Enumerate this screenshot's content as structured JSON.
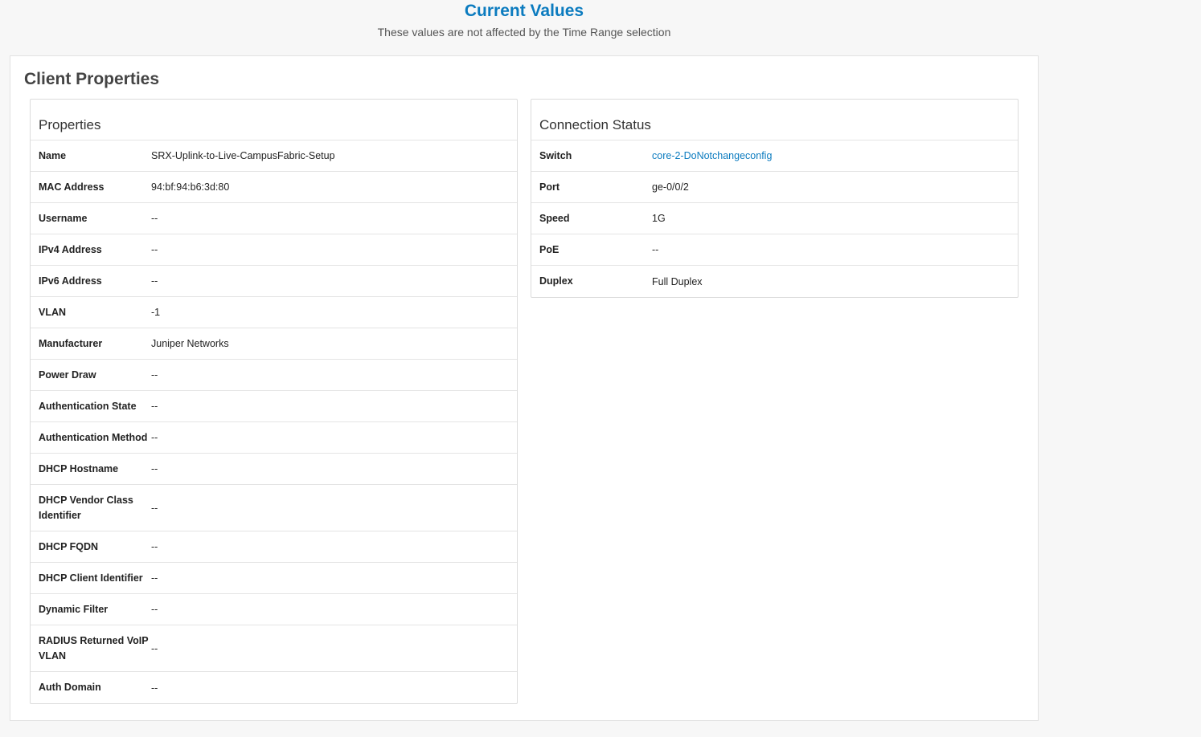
{
  "header": {
    "title": "Current Values",
    "subtitle": "These values are not affected by the Time Range selection"
  },
  "card": {
    "title": "Client Properties"
  },
  "properties": {
    "title": "Properties",
    "rows": [
      {
        "key": "Name",
        "value": "SRX-Uplink-to-Live-CampusFabric-Setup"
      },
      {
        "key": "MAC Address",
        "value": "94:bf:94:b6:3d:80"
      },
      {
        "key": "Username",
        "value": "--"
      },
      {
        "key": "IPv4 Address",
        "value": "--"
      },
      {
        "key": "IPv6 Address",
        "value": "--"
      },
      {
        "key": "VLAN",
        "value": "-1"
      },
      {
        "key": "Manufacturer",
        "value": "Juniper Networks"
      },
      {
        "key": "Power Draw",
        "value": "--"
      },
      {
        "key": "Authentication State",
        "value": "--"
      },
      {
        "key": "Authentication Method",
        "value": "--"
      },
      {
        "key": "DHCP Hostname",
        "value": "--"
      },
      {
        "key": "DHCP Vendor Class Identifier",
        "value": "--"
      },
      {
        "key": "DHCP FQDN",
        "value": "--"
      },
      {
        "key": "DHCP Client Identifier",
        "value": "--"
      },
      {
        "key": "Dynamic Filter",
        "value": "--"
      },
      {
        "key": "RADIUS Returned VoIP VLAN",
        "value": "--"
      },
      {
        "key": "Auth Domain",
        "value": "--"
      }
    ]
  },
  "connection": {
    "title": "Connection Status",
    "rows": [
      {
        "key": "Switch",
        "value": "core-2-DoNotchangeconfig"
      },
      {
        "key": "Port",
        "value": "ge-0/0/2"
      },
      {
        "key": "Speed",
        "value": "1G"
      },
      {
        "key": "PoE",
        "value": "--"
      },
      {
        "key": "Duplex",
        "value": "Full Duplex"
      }
    ]
  },
  "colors": {
    "accent": "#0b7bbf",
    "background": "#f7f7f7"
  }
}
